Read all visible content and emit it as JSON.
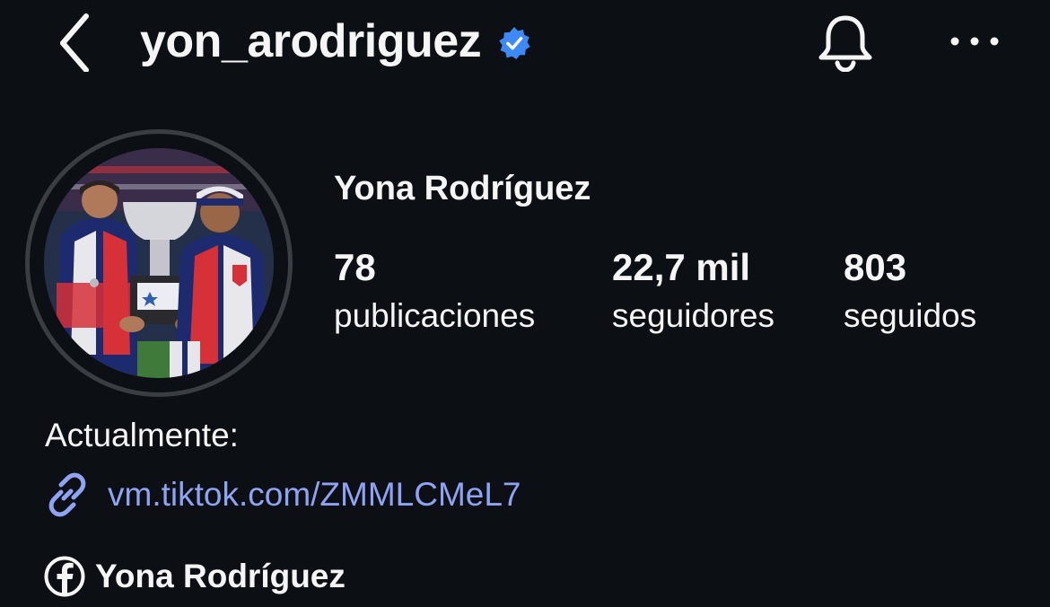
{
  "header": {
    "username": "yon_arodriguez",
    "verified": true
  },
  "profile": {
    "display_name": "Yona Rodríguez",
    "stats": {
      "posts": {
        "value": "78",
        "label": "publicaciones"
      },
      "followers": {
        "value": "22,7 mil",
        "label": "seguidores"
      },
      "following": {
        "value": "803",
        "label": "seguidos"
      }
    }
  },
  "bio": {
    "text": "Actualmente:",
    "link": "vm.tiktok.com/ZMMLCMeL7",
    "facebook_name": "Yona Rodríguez"
  },
  "icons": {
    "back": "chevron-left-icon",
    "verified": "verified-badge-icon",
    "notifications": "bell-icon",
    "more": "more-horizontal-icon",
    "link": "link-icon",
    "facebook": "facebook-icon"
  },
  "colors": {
    "background": "#0c1014",
    "text": "#f5f5f5",
    "link": "#8fa3f2",
    "verified": "#3d8af7"
  }
}
